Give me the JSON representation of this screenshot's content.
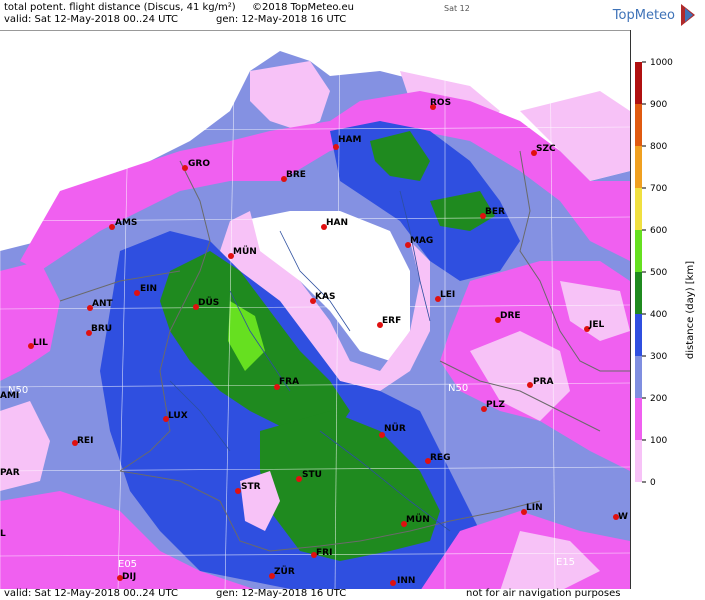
{
  "header": {
    "title": "total potent. flight distance (Discus, 41 kg/m²)",
    "copyright": "©2018 TopMeteo.eu",
    "day": "Sat 12",
    "valid": "valid:  Sat  12-May-2018  00..24 UTC",
    "gen": "gen: 12-May-2018 16 UTC",
    "brand": "TopMeteo"
  },
  "footer": {
    "valid": "valid:  Sat  12-May-2018  00..24 UTC",
    "gen": "gen: 12-May-2018 16 UTC",
    "disclaimer": "not for air navigation purposes"
  },
  "legend": {
    "axis_label": "distance (day) [km]",
    "ticks": [
      "1000",
      "900",
      "800",
      "700",
      "600",
      "500",
      "400",
      "300",
      "200",
      "100",
      "0"
    ],
    "colors": [
      "#b01010",
      "#e05a10",
      "#f0a020",
      "#f0e040",
      "#66e020",
      "#1f8a1f",
      "#2f4fe0",
      "#7f8ee0",
      "#f060f0",
      "#f7c2f7"
    ]
  },
  "map": {
    "grid_labels": {
      "n55_left": "N55",
      "n55_right": "N55",
      "n50_left": "N50",
      "n50_right": "N50",
      "e05": "E05",
      "e15": "E15"
    },
    "cities": [
      {
        "id": "ros",
        "name": "ROS"
      },
      {
        "id": "ham",
        "name": "HAM"
      },
      {
        "id": "szc",
        "name": "SZC"
      },
      {
        "id": "gro",
        "name": "GRO"
      },
      {
        "id": "bre",
        "name": "BRE"
      },
      {
        "id": "ams",
        "name": "AMS"
      },
      {
        "id": "han",
        "name": "HAN"
      },
      {
        "id": "ber",
        "name": "BER"
      },
      {
        "id": "mag",
        "name": "MAG"
      },
      {
        "id": "mun1",
        "name": "MÜN"
      },
      {
        "id": "ein",
        "name": "EIN"
      },
      {
        "id": "ant",
        "name": "ANT"
      },
      {
        "id": "kas",
        "name": "KAS"
      },
      {
        "id": "lei",
        "name": "LEI"
      },
      {
        "id": "dus",
        "name": "DÜS"
      },
      {
        "id": "bru",
        "name": "BRU"
      },
      {
        "id": "erf",
        "name": "ERF"
      },
      {
        "id": "dre",
        "name": "DRE"
      },
      {
        "id": "jel",
        "name": "JEL"
      },
      {
        "id": "lil",
        "name": "LIL"
      },
      {
        "id": "fra",
        "name": "FRA"
      },
      {
        "id": "pra",
        "name": "PRA"
      },
      {
        "id": "ami",
        "name": "AMI"
      },
      {
        "id": "lux",
        "name": "LUX"
      },
      {
        "id": "plz",
        "name": "PLZ"
      },
      {
        "id": "nur",
        "name": "NÜR"
      },
      {
        "id": "rei",
        "name": "REI"
      },
      {
        "id": "reg",
        "name": "REG"
      },
      {
        "id": "par",
        "name": "PAR"
      },
      {
        "id": "stu",
        "name": "STU"
      },
      {
        "id": "str",
        "name": "STR"
      },
      {
        "id": "lin",
        "name": "LIN"
      },
      {
        "id": "mun2",
        "name": "MÜN"
      },
      {
        "id": "w",
        "name": "W"
      },
      {
        "id": "l",
        "name": "L"
      },
      {
        "id": "fri",
        "name": "FRI"
      },
      {
        "id": "dij",
        "name": "DIJ"
      },
      {
        "id": "zur",
        "name": "ZÜR"
      },
      {
        "id": "inn",
        "name": "INN"
      }
    ]
  }
}
